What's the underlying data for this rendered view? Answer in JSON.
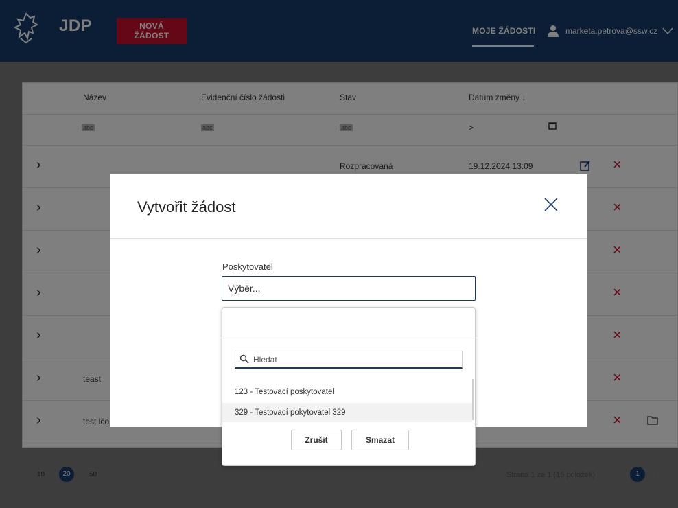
{
  "header": {
    "app_title": "JDP",
    "new_request_label": "NOVÁ ŽÁDOST",
    "my_requests_label": "MOJE ŽÁDOSTI",
    "user_email": "marketa.petrova@ssw.cz"
  },
  "table": {
    "columns": [
      "Název",
      "Evidenční číslo žádosti",
      "Stav",
      "Datum změny ↓"
    ],
    "filter_hint": "abc",
    "filter_date_op": ">",
    "rows": [
      {
        "name": "",
        "status": "Rozpracovaná",
        "date": "19.12.2024 13:09"
      },
      {
        "name": "",
        "status": "",
        "date": ""
      },
      {
        "name": "",
        "status": "",
        "date": ""
      },
      {
        "name": "",
        "status": "",
        "date": ""
      },
      {
        "name": "",
        "status": "",
        "date": ""
      },
      {
        "name": "teast",
        "status": "",
        "date": ""
      },
      {
        "name": "test lčo",
        "status": "",
        "date": ""
      }
    ]
  },
  "pager": {
    "sizes": [
      "10",
      "20",
      "50"
    ],
    "selected_size": "20",
    "info": "Strana 1 ze 1 (15 položek)",
    "current_page": "1"
  },
  "dialog": {
    "title": "Vytvořit žádost",
    "field_label": "Poskytovatel",
    "select_placeholder": "Výběr...",
    "dropdown": {
      "search_placeholder": "Hledat",
      "options": [
        "123 - Testovací poskytovatel",
        "329 - Testovací pokytovatel 329"
      ],
      "cancel_label": "Zrušit",
      "clear_label": "Smazat"
    }
  },
  "colors": {
    "primary": "#183a6d",
    "danger": "#c8102e"
  }
}
